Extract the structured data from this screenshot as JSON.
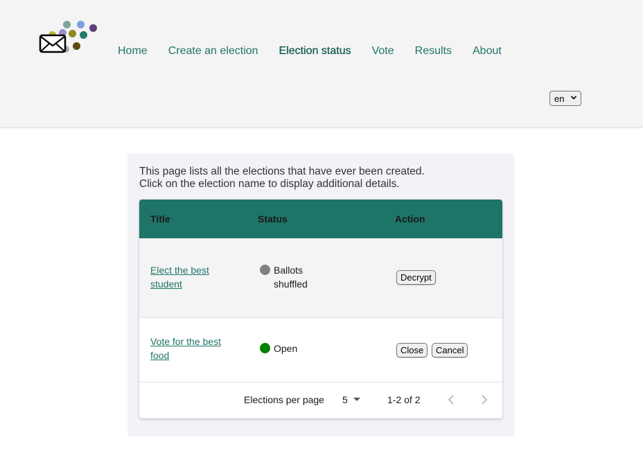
{
  "header": {
    "logo_icon": "envelope-dots-logo",
    "nav": [
      {
        "label": "Home"
      },
      {
        "label": "Create an election"
      },
      {
        "label": "Election status",
        "active": true
      },
      {
        "label": "Vote"
      },
      {
        "label": "Results"
      },
      {
        "label": "About"
      }
    ],
    "language": {
      "selected": "en"
    }
  },
  "main": {
    "intro_line1": "This page lists all the elections that have ever been created.",
    "intro_line2": "Click on the election name to display additional details.",
    "table": {
      "header_color": "#1e7467",
      "columns": [
        "Title",
        "Status",
        "Action"
      ],
      "rows": [
        {
          "title": "Elect the best student",
          "status": "Ballots shuffled",
          "status_color": "#808080",
          "actions": [
            "Decrypt"
          ]
        },
        {
          "title": "Vote for the best food",
          "status": "Open",
          "status_color": "#008000",
          "actions": [
            "Close",
            "Cancel"
          ]
        }
      ],
      "pagination": {
        "per_page_label": "Elections per page",
        "per_page_value": "5",
        "range": "1-2 of 2"
      }
    }
  },
  "colors": {
    "link": "#1f7467",
    "header_bg": "#f4f4f5",
    "card_bg": "#f3f2f7"
  }
}
